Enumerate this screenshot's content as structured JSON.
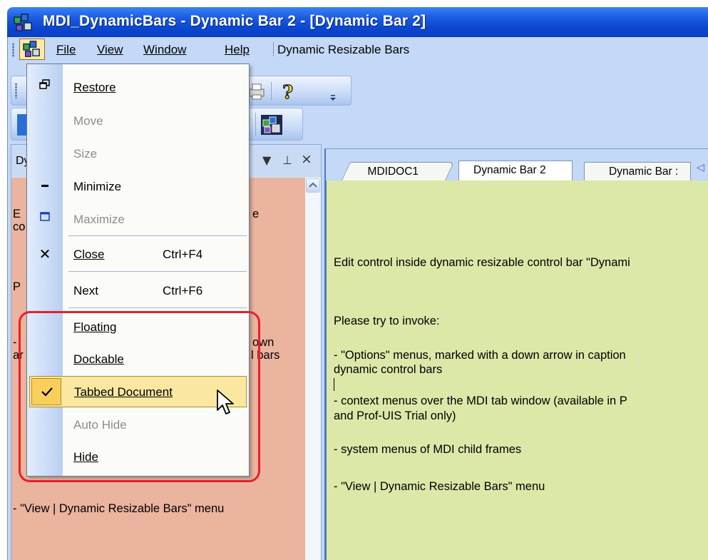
{
  "window": {
    "title": "MDI_DynamicBars - Dynamic Bar 2 - [Dynamic Bar 2]"
  },
  "menubar": {
    "items": [
      "File",
      "View",
      "Window",
      "Help"
    ],
    "extra": "Dynamic Resizable Bars"
  },
  "left_bar": {
    "caption": "Dy",
    "text_lines": [
      "E",
      "co",
      "P",
      "-",
      "ar",
      "- \"View | Dynamic Resizable Bars\" menu"
    ],
    "text_right_fragments": [
      "e",
      "own",
      "l bars"
    ]
  },
  "tabs": [
    "MDIDOC1",
    "Dynamic Bar 2",
    "Dynamic Bar :"
  ],
  "document": {
    "lines": [
      "Edit control inside dynamic resizable control bar \"Dynami",
      "Please try to invoke:",
      "- \"Options\" menus, marked with a down arrow in caption",
      "dynamic control bars",
      "- context menus over the MDI tab window (available in P",
      "and Prof-UIS Trial only)",
      "- system menus of MDI child frames",
      "- \"View | Dynamic Resizable Bars\" menu"
    ]
  },
  "system_menu": {
    "items": [
      {
        "label": "Restore",
        "shortcut": "",
        "icon": "restore-icon",
        "disabled": false
      },
      {
        "label": "Move",
        "shortcut": "",
        "icon": "",
        "disabled": true
      },
      {
        "label": "Size",
        "shortcut": "",
        "icon": "",
        "disabled": true
      },
      {
        "label": "Minimize",
        "shortcut": "",
        "icon": "minimize-icon",
        "disabled": false
      },
      {
        "label": "Maximize",
        "shortcut": "",
        "icon": "maximize-icon",
        "disabled": true
      },
      {
        "label": "Close",
        "shortcut": "Ctrl+F4",
        "icon": "close-icon",
        "disabled": false
      },
      {
        "label": "Next",
        "shortcut": "Ctrl+F6",
        "icon": "",
        "disabled": false
      },
      {
        "label": "Floating",
        "shortcut": "",
        "icon": "",
        "disabled": false
      },
      {
        "label": "Dockable",
        "shortcut": "",
        "icon": "",
        "disabled": false
      },
      {
        "label": "Tabbed Document",
        "shortcut": "",
        "icon": "check-icon",
        "disabled": false,
        "checked": true,
        "highlighted": true
      },
      {
        "label": "Auto Hide",
        "shortcut": "",
        "icon": "",
        "disabled": true
      },
      {
        "label": "Hide",
        "shortcut": "",
        "icon": "",
        "disabled": false
      }
    ]
  },
  "colors": {
    "titlebar": "#0b47d1",
    "left_pane": "#eab49e",
    "document_bg": "#dce8a8",
    "annotation": "#e8202a",
    "menu_highlight": "#fbe8a0"
  }
}
